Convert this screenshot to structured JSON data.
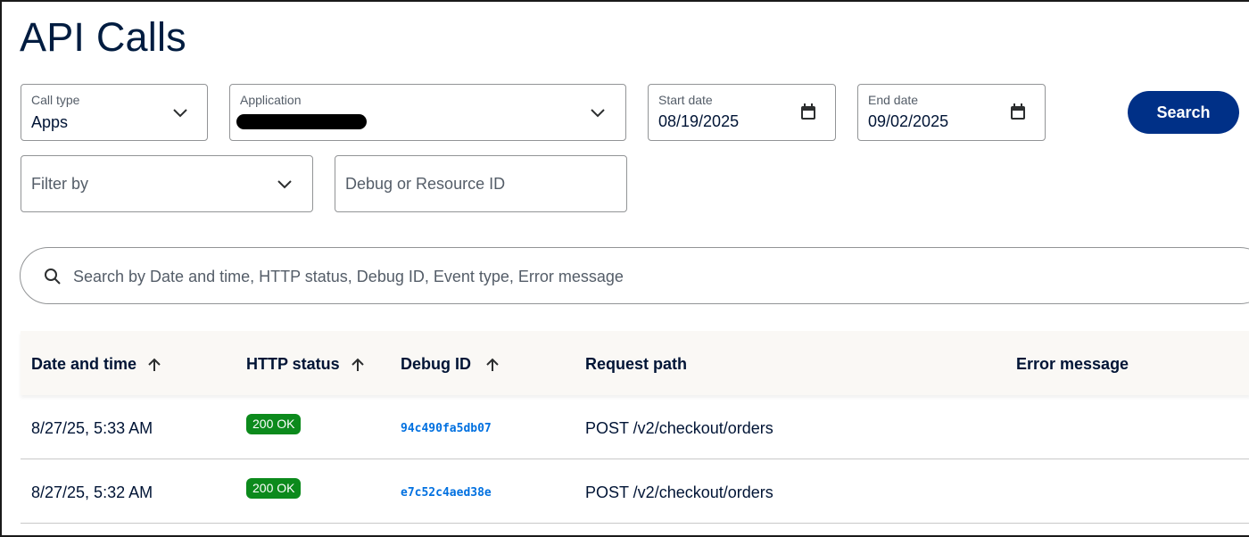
{
  "page": {
    "title": "API Calls"
  },
  "filters": {
    "call_type": {
      "label": "Call type",
      "value": "Apps"
    },
    "application": {
      "label": "Application"
    },
    "start_date": {
      "label": "Start date",
      "value": "08/19/2025"
    },
    "end_date": {
      "label": "End date",
      "value": "09/02/2025"
    },
    "filter_by": {
      "placeholder": "Filter by"
    },
    "debug_id": {
      "placeholder": "Debug or Resource ID"
    },
    "search_button": "Search"
  },
  "search": {
    "placeholder": "Search by Date and time, HTTP status, Debug ID, Event type, Error message"
  },
  "table": {
    "headers": [
      "Date and time",
      "HTTP status",
      "Debug ID",
      "Request path",
      "Error message"
    ],
    "rows": [
      {
        "datetime": "8/27/25, 5:33 AM",
        "status": "200 OK",
        "debug_id": "94c490fa5db07",
        "path": "POST /v2/checkout/orders",
        "error": ""
      },
      {
        "datetime": "8/27/25, 5:32 AM",
        "status": "200 OK",
        "debug_id": "e7c52c4aed38e",
        "path": "POST /v2/checkout/orders",
        "error": ""
      }
    ]
  },
  "colors": {
    "primary": "#003087",
    "success": "#0c8a1c",
    "link": "#0070e0"
  }
}
